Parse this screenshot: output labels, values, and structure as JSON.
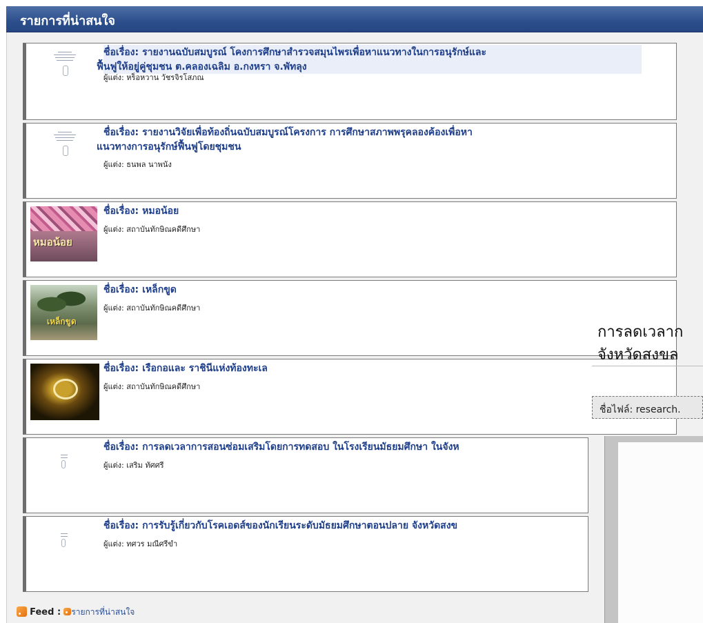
{
  "header": {
    "title": "รายการที่น่าสนใจ"
  },
  "items": [
    {
      "label": "ชื่อเรื่อง:",
      "title_line1": "รายงานฉบับสมบูรณ์ โคงการศึกษาสำรวจสมุนไพรเพื่อหาแนวทางในการอนุรักษ์และ",
      "title_line2": "ฟื้นฟูให้อยู่คู่ชุมชน ต.คลองเฉลิม อ.กงหรา จ.พัทลุง",
      "author_label": "ผู้แต่ง:",
      "author": "หร็อหวาน วัชรจิรโสภณ",
      "thumb": "document-cover"
    },
    {
      "label": "ชื่อเรื่อง:",
      "title_line1": "รายงานวิจัยเพื่อท้องถิ่นฉบับสมบูรณ์โครงการ การศึกษาสภาพพรุคลองค้องเพื่อหา",
      "title_line2": "แนวทางการอนุรักษ์ฟื้นฟูโดยชุมชน",
      "author_label": "ผู้แต่ง:",
      "author": "ธนพล นาพนัง",
      "thumb": "document-cover"
    },
    {
      "label": "ชื่อเรื่อง:",
      "title_line1": "หมอน้อย",
      "title_line2": "",
      "author_label": "ผู้แต่ง:",
      "author": "สถาบันทักษิณคดีศึกษา",
      "thumb": "video-pink",
      "thumb_text": "หมอน้อย"
    },
    {
      "label": "ชื่อเรื่อง:",
      "title_line1": "เหล็กขูด",
      "title_line2": "",
      "author_label": "ผู้แต่ง:",
      "author": "สถาบันทักษิณคดีศึกษา",
      "thumb": "video-palm",
      "thumb_text": "เหล็กขูด"
    },
    {
      "label": "ชื่อเรื่อง:",
      "title_line1": "เรือกอและ ราชินีแห่งท้องทะเล",
      "title_line2": "",
      "author_label": "ผู้แต่ง:",
      "author": "สถาบันทักษิณคดีศึกษา",
      "thumb": "video-logo"
    },
    {
      "label": "ชื่อเรื่อง:",
      "title_line1": "การลดเวลาการสอนซ่อมเสริมโดยการทดสอบ ในโรงเรียนมัธยมศึกษา ในจังห",
      "title_line2": "",
      "author_label": "ผู้แต่ง:",
      "author": "เสริม ทัศศรี",
      "thumb": "document-small"
    },
    {
      "label": "ชื่อเรื่อง:",
      "title_line1": "การรับรู้เกี่ยวกับโรคเอดส์ของนักเรียนระดับมัธยมศึกษาตอนปลาย จังหวัดสงข",
      "title_line2": "",
      "author_label": "ผู้แต่ง:",
      "author": "ทศวร มณีศรีขำ",
      "thumb": "document-small"
    }
  ],
  "popup": {
    "title_line1": "การลดเวลาก",
    "title_line2": "จังหวัดสงขล",
    "file_label": "ชื่อไฟล์: research."
  },
  "feed": {
    "label": "Feed :",
    "link": "รายการที่น่าสนใจ",
    "icon": "rss-icon",
    "accent": "#f08a24"
  }
}
